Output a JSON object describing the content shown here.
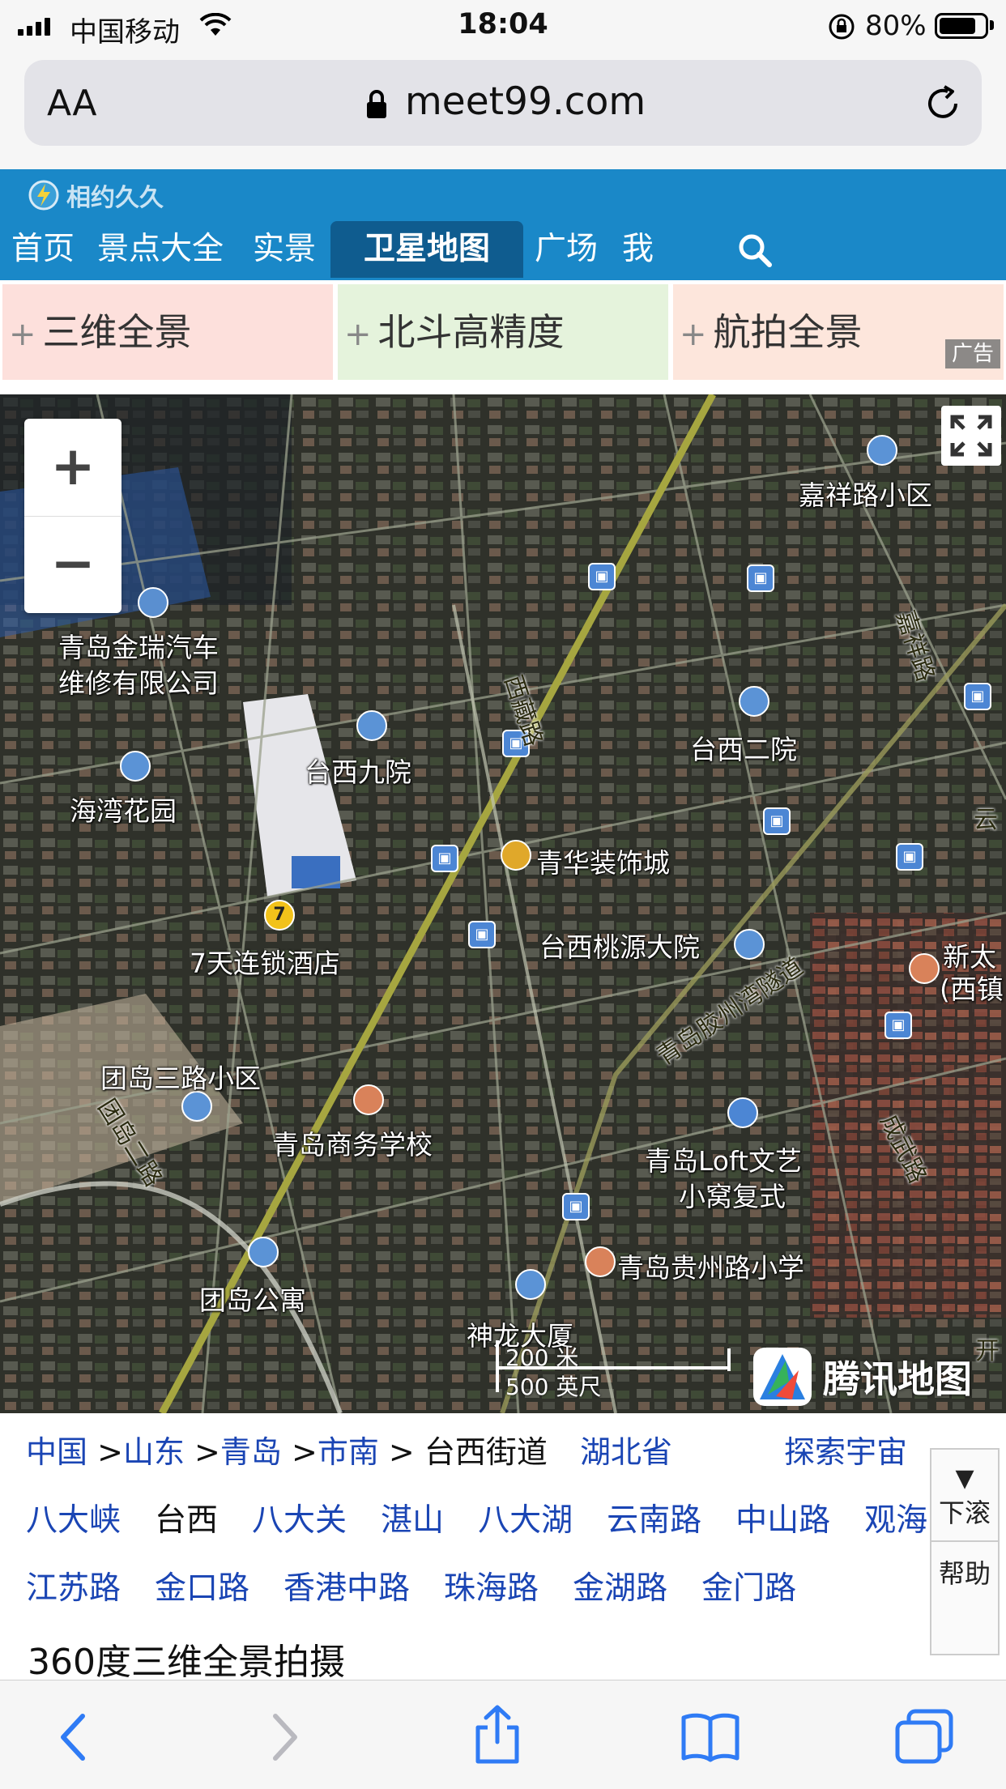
{
  "status_bar": {
    "carrier": "中国移动",
    "time": "18:04",
    "battery": "80%"
  },
  "browser": {
    "text_size_label": "AA",
    "url": "meet99.com"
  },
  "site": {
    "logo": "相约久久",
    "nav": [
      "首页",
      "景点大全",
      "实景",
      "卫星地图",
      "广场",
      "我"
    ],
    "active_tab": "卫星地图"
  },
  "ads": {
    "items": [
      "三维全景",
      "北斗高精度",
      "航拍全景"
    ],
    "colors": [
      "#fde0dc",
      "#e5f3dc",
      "#fde6dc"
    ],
    "badge": "广告"
  },
  "map": {
    "zoom_in": "+",
    "zoom_out": "−",
    "place_labels": [
      "嘉祥路小区",
      "青岛金瑞汽车",
      "维修有限公司",
      "台西九院",
      "海湾花园",
      "台西二院",
      "青华装饰城",
      "7天连锁酒店",
      "台西桃源大院",
      "团岛三路小区",
      "青岛商务学校",
      "青岛Loft文艺",
      "小窝复式",
      "青岛贵州路小学",
      "团岛公寓",
      "神龙大厦",
      "新太",
      "(西镇"
    ],
    "road_labels": [
      "西藏路",
      "嘉祥路",
      "青岛胶州湾隧道",
      "团岛二路",
      "成武路",
      "云",
      "开"
    ],
    "hotel_badge": "7",
    "scale_metric": "200 米",
    "scale_imperial": "500 英尺",
    "provider": "腾讯地图"
  },
  "breadcrumb": {
    "items": [
      "中国",
      "山东",
      "青岛",
      "市南"
    ],
    "current": "台西街道",
    "extra": [
      "湖北省",
      "探索宇宙"
    ]
  },
  "nearby": {
    "row1": [
      "八大峡",
      "台西",
      "八大关",
      "湛山",
      "八大湖",
      "云南路",
      "中山路",
      "观海"
    ],
    "row2": [
      "江苏路",
      "金口路",
      "香港中路",
      "珠海路",
      "金湖路",
      "金门路"
    ],
    "current": "台西"
  },
  "side_buttons": {
    "scroll_down": "下滚",
    "help": "帮助"
  },
  "section_heading": "360度三维全景拍摄"
}
